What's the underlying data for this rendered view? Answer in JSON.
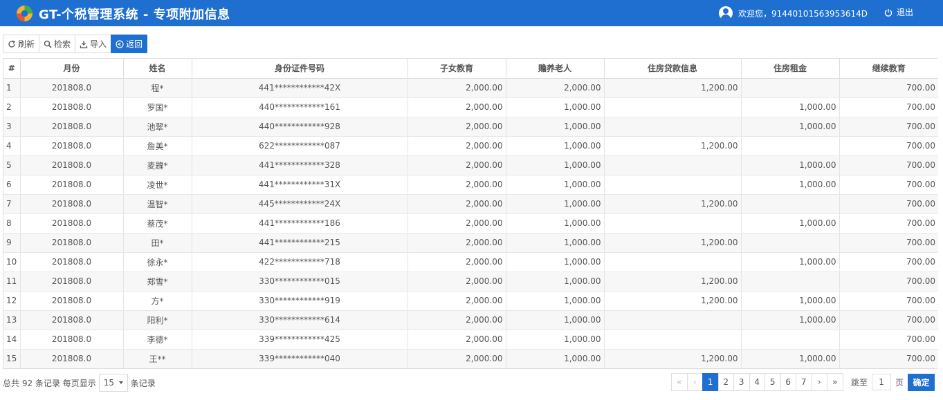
{
  "header": {
    "title": "GT-个税管理系统 - 专项附加信息",
    "welcome": "欢迎您，91440101563953614D",
    "logout_label": "退出",
    "colors": {
      "bar": "#1f6fd1"
    }
  },
  "toolbar": {
    "refresh_label": "刷新",
    "search_label": "检索",
    "import_label": "导入",
    "back_label": "返回"
  },
  "table": {
    "columns": [
      "#",
      "月份",
      "姓名",
      "身份证件号码",
      "子女教育",
      "赡养老人",
      "住房贷款信息",
      "住房租金",
      "继续教育"
    ],
    "rows": [
      [
        "1",
        "201808.0",
        "程*",
        "441************42X",
        "2,000.00",
        "2,000.00",
        "1,200.00",
        "",
        "700.00"
      ],
      [
        "2",
        "201808.0",
        "罗国*",
        "440************161",
        "2,000.00",
        "1,000.00",
        "",
        "1,000.00",
        "700.00"
      ],
      [
        "3",
        "201808.0",
        "池翠*",
        "440************928",
        "2,000.00",
        "1,000.00",
        "",
        "1,000.00",
        "700.00"
      ],
      [
        "4",
        "201808.0",
        "詹美*",
        "622************087",
        "2,000.00",
        "1,000.00",
        "1,200.00",
        "",
        "700.00"
      ],
      [
        "5",
        "201808.0",
        "麦韙*",
        "441************328",
        "2,000.00",
        "1,000.00",
        "",
        "1,000.00",
        "700.00"
      ],
      [
        "6",
        "201808.0",
        "凌世*",
        "441************31X",
        "2,000.00",
        "1,000.00",
        "",
        "1,000.00",
        "700.00"
      ],
      [
        "7",
        "201808.0",
        "温智*",
        "445************24X",
        "2,000.00",
        "1,000.00",
        "1,200.00",
        "",
        "700.00"
      ],
      [
        "8",
        "201808.0",
        "蔡茂*",
        "441************186",
        "2,000.00",
        "1,000.00",
        "",
        "1,000.00",
        "700.00"
      ],
      [
        "9",
        "201808.0",
        "田*",
        "441************215",
        "2,000.00",
        "1,000.00",
        "1,200.00",
        "",
        "700.00"
      ],
      [
        "10",
        "201808.0",
        "徐永*",
        "422************718",
        "2,000.00",
        "1,000.00",
        "",
        "1,000.00",
        "700.00"
      ],
      [
        "11",
        "201808.0",
        "郑雪*",
        "330************015",
        "2,000.00",
        "1,000.00",
        "1,200.00",
        "",
        "700.00"
      ],
      [
        "12",
        "201808.0",
        "方*",
        "330************919",
        "2,000.00",
        "1,000.00",
        "1,200.00",
        "1,000.00",
        "700.00"
      ],
      [
        "13",
        "201808.0",
        "阳利*",
        "330************614",
        "2,000.00",
        "1,000.00",
        "",
        "1,000.00",
        "700.00"
      ],
      [
        "14",
        "201808.0",
        "李德*",
        "339************425",
        "2,000.00",
        "1,000.00",
        "",
        "",
        "700.00"
      ],
      [
        "15",
        "201808.0",
        "王**",
        "339************040",
        "2,000.00",
        "1,000.00",
        "1,200.00",
        "1,000.00",
        "700.00"
      ]
    ]
  },
  "footer": {
    "total_text": "总共 92 条记录 每页显示",
    "page_size": "15",
    "records_suffix": "条记录",
    "pager": {
      "first": "«",
      "prev": "‹",
      "pages": [
        "1",
        "2",
        "3",
        "4",
        "5",
        "6",
        "7"
      ],
      "current": "1",
      "next": "›",
      "last": "»"
    },
    "jump_label": "跳至",
    "jump_value": "1",
    "page_unit": "页",
    "confirm_label": "确定"
  }
}
